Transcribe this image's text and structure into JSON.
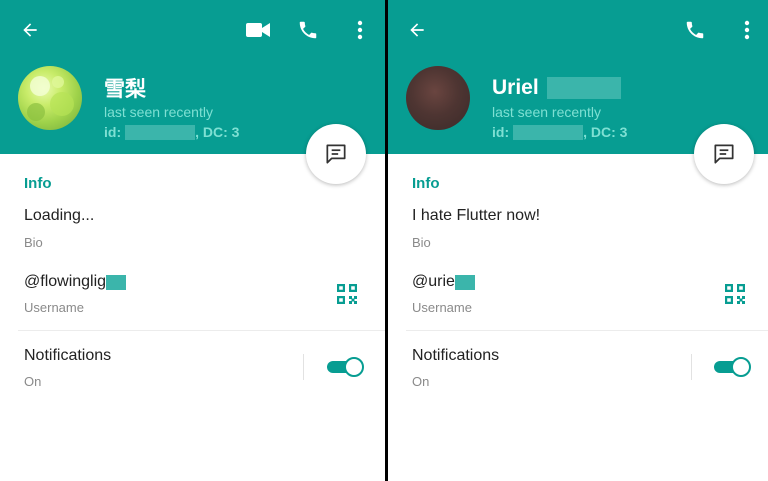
{
  "colors": {
    "accent": "#079d92",
    "accent_light": "#7ee0d3",
    "redaction": "#3bb5ab",
    "text": "#222222",
    "muted": "#8a8a8a"
  },
  "left_profile": {
    "name": "雪梨",
    "status": "last seen recently",
    "id_prefix": "id:",
    "dc": ", DC: 3",
    "section_title": "Info",
    "bio": "Loading...",
    "bio_label": "Bio",
    "username": "@flowinglig",
    "username_label": "Username",
    "notifications_label": "Notifications",
    "notifications_value": "On",
    "notifications_enabled": true,
    "toolbar_icons": [
      "back-arrow-icon",
      "video-call-icon",
      "phone-icon",
      "more-vertical-icon"
    ],
    "fab_icon": "message-icon",
    "qr_icon": "qr-code-icon"
  },
  "right_profile": {
    "name": "Uriel",
    "status": "last seen recently",
    "id_prefix": "id:",
    "dc": ", DC: 3",
    "section_title": "Info",
    "bio": "I hate Flutter now!",
    "bio_label": "Bio",
    "username": "@urie",
    "username_label": "Username",
    "notifications_label": "Notifications",
    "notifications_value": "On",
    "notifications_enabled": true,
    "toolbar_icons": [
      "back-arrow-icon",
      "phone-icon",
      "more-vertical-icon"
    ],
    "fab_icon": "message-icon",
    "qr_icon": "qr-code-icon"
  }
}
